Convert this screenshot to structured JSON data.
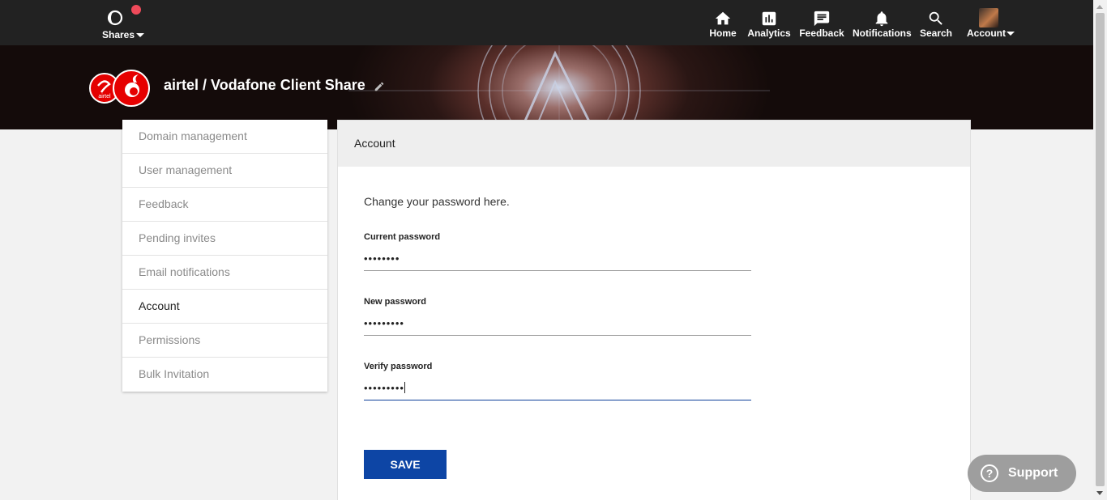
{
  "topbar": {
    "shares_label": "Shares",
    "nav": [
      {
        "label": "Home",
        "icon": "home-icon"
      },
      {
        "label": "Analytics",
        "icon": "analytics-icon"
      },
      {
        "label": "Feedback",
        "icon": "feedback-icon"
      },
      {
        "label": "Notifications",
        "icon": "bell-icon"
      },
      {
        "label": "Search",
        "icon": "search-icon"
      },
      {
        "label": "Account",
        "icon": "avatar"
      }
    ],
    "notification_dot_color": "#ef4a5a"
  },
  "banner": {
    "title": "airtel / Vodafone Client Share"
  },
  "sidebar": {
    "items": [
      {
        "label": "Domain management"
      },
      {
        "label": "User management"
      },
      {
        "label": "Feedback"
      },
      {
        "label": "Pending invites"
      },
      {
        "label": "Email notifications"
      },
      {
        "label": "Account"
      },
      {
        "label": "Permissions"
      },
      {
        "label": "Bulk Invitation"
      }
    ],
    "active": "Account"
  },
  "panel": {
    "title": "Account",
    "intro": "Change your password here.",
    "fields": {
      "current": {
        "label": "Current password",
        "value": "••••••••"
      },
      "new": {
        "label": "New password",
        "value": "•••••••••"
      },
      "verify": {
        "label": "Verify password",
        "value": "•••••••••"
      }
    },
    "save_label": "SAVE"
  },
  "support": {
    "label": "Support"
  },
  "colors": {
    "primary": "#0d45a5",
    "topbar": "#222222",
    "brand_red": "#e60000"
  }
}
